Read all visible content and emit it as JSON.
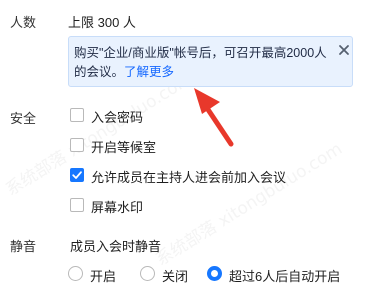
{
  "participants": {
    "label": "人数",
    "value": "上限 300 人"
  },
  "tip": {
    "message": "购买\"企业/商业版\"帐号后，可召开最高2000人的会议。",
    "link": "了解更多"
  },
  "security": {
    "label": "安全",
    "options": [
      {
        "label": "入会密码",
        "checked": false
      },
      {
        "label": "开启等候室",
        "checked": false
      },
      {
        "label": "允许成员在主持人进会前加入会议",
        "checked": true
      },
      {
        "label": "屏幕水印",
        "checked": false
      }
    ]
  },
  "mute": {
    "label": "静音",
    "description": "成员入会时静音",
    "options": [
      {
        "label": "开启",
        "selected": false
      },
      {
        "label": "关闭",
        "selected": false
      },
      {
        "label": "超过6人后自动开启",
        "selected": true
      }
    ]
  },
  "annotation_color": "#e8382b",
  "accent_color": "#1677ff",
  "watermark": "系统部落 xitongbuluo.com"
}
